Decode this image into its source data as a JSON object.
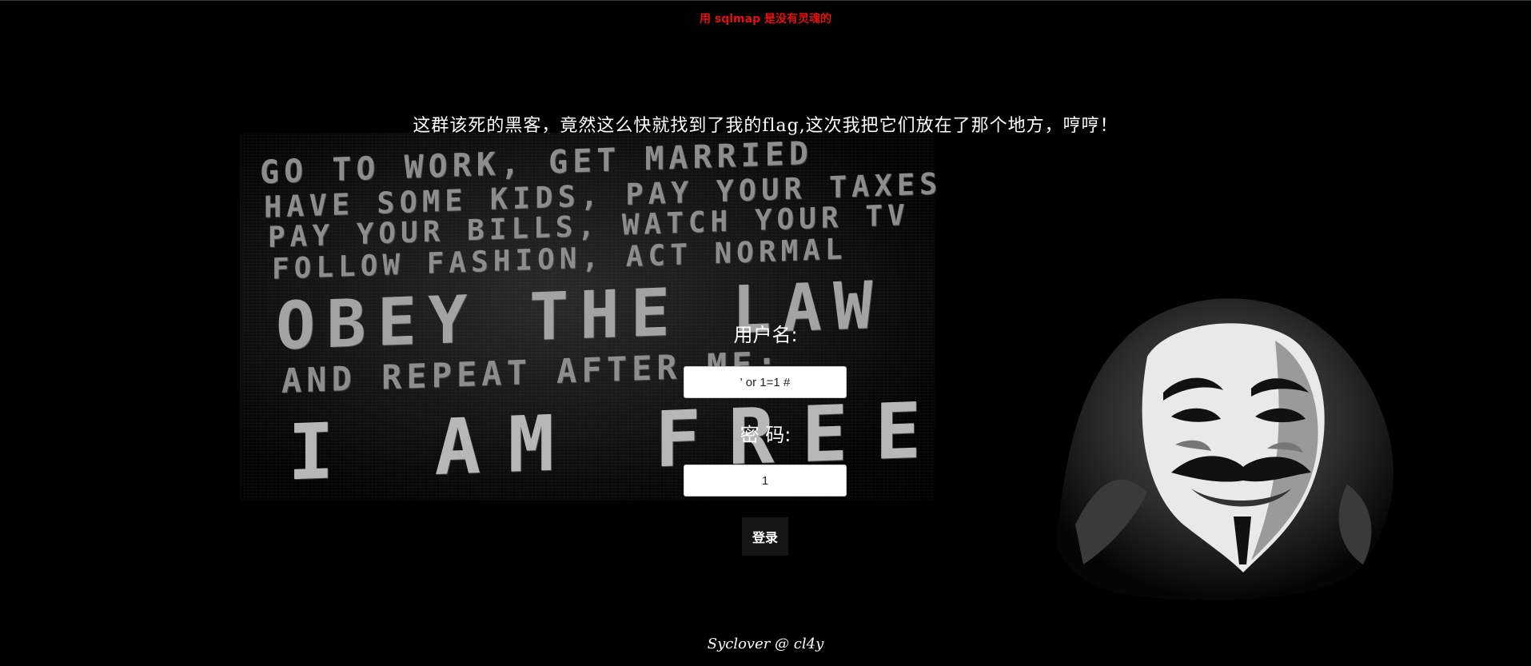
{
  "banner": {
    "text": "用 sqlmap 是没有灵魂的",
    "color": "#e3110d"
  },
  "headline": "这群该死的黑客，竟然这么快就找到了我的flag,这次我把它们放在了那个地方，哼哼！",
  "poster": {
    "lines": [
      "GO TO WORK, GET MARRIED",
      "HAVE SOME KIDS, PAY YOUR TAXES",
      "PAY YOUR BILLS, WATCH YOUR TV",
      "FOLLOW FASHION, ACT NORMAL",
      "OBEY THE LAW",
      "AND REPEAT AFTER ME:",
      "I AM FREE"
    ]
  },
  "login": {
    "username_label": "用户名:",
    "username_value": "' or 1=1 #",
    "password_label": "密 码:",
    "password_value": "1",
    "submit_label": "登录"
  },
  "footer": "Syclover @ cl4y"
}
